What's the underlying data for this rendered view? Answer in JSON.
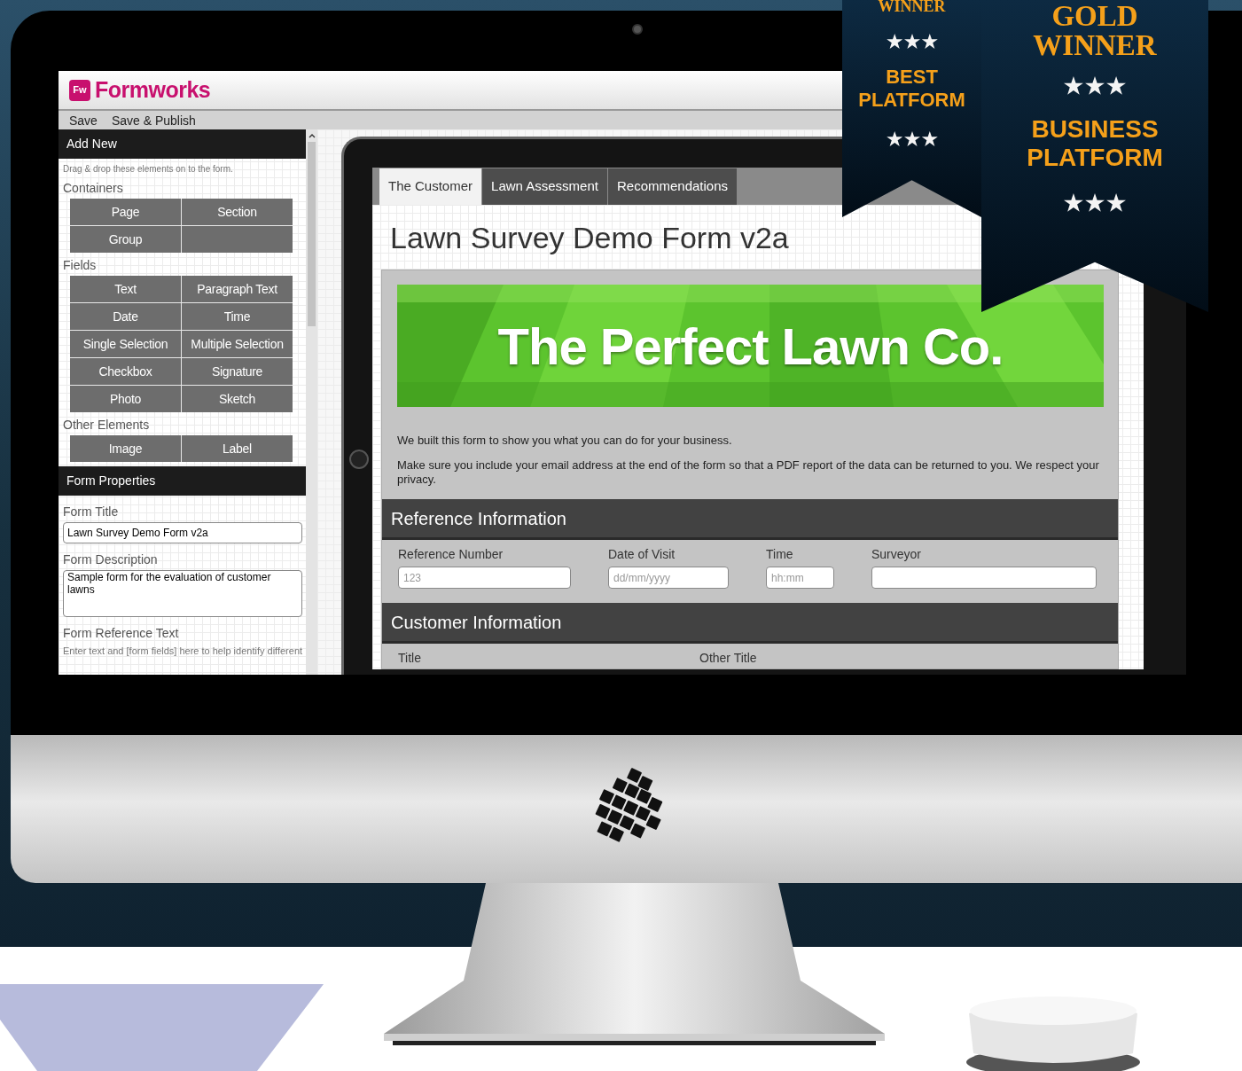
{
  "app": {
    "logo_badge": "Fw",
    "logo": "Formworks",
    "menu": [
      "Save",
      "Save & Publish"
    ],
    "add_new": {
      "title": "Add New",
      "hint": "Drag & drop these elements on to the form.",
      "groups": [
        {
          "title": "Containers",
          "items": [
            "Page",
            "Section",
            "Group"
          ]
        },
        {
          "title": "Fields",
          "items": [
            "Text",
            "Paragraph Text",
            "Date",
            "Time",
            "Single Selection",
            "Multiple Selection",
            "Checkbox",
            "Signature",
            "Photo",
            "Sketch"
          ]
        },
        {
          "title": "Other Elements",
          "items": [
            "Image",
            "Label"
          ]
        }
      ]
    },
    "form_properties": {
      "title": "Form Properties",
      "fields": [
        {
          "kind": "input",
          "label": "Form Title",
          "value": "Lawn Survey Demo Form v2a"
        },
        {
          "kind": "textarea",
          "label": "Form Description",
          "value": "Sample form for the evaluation of customer lawns"
        },
        {
          "kind": "hint",
          "label": "Form Reference Text",
          "hint": "Enter text and [form fields] here to help identify different"
        }
      ]
    }
  },
  "form": {
    "tabs": [
      {
        "label": "The Customer",
        "selected": true
      },
      {
        "label": "Lawn Assessment",
        "selected": false
      },
      {
        "label": "Recommendations",
        "selected": false
      }
    ],
    "title": "Lawn Survey Demo Form v2a",
    "banner_text": "The Perfect Lawn Co.",
    "intro": [
      "We built this form to show you what you can do for your business.",
      "Make sure you include your email address at the end of the form so that a PDF report of the data can be returned to you. We respect your privacy."
    ],
    "sections": [
      {
        "title": "Reference Information",
        "fields": [
          {
            "label": "Reference Number",
            "placeholder": "123"
          },
          {
            "label": "Date of Visit",
            "placeholder": "dd/mm/yyyy"
          },
          {
            "label": "Time",
            "placeholder": "hh:mm"
          },
          {
            "label": "Surveyor"
          }
        ]
      },
      {
        "title": "Customer Information",
        "fields": [
          {
            "label": "Title"
          },
          {
            "label": "Other Title"
          }
        ]
      }
    ]
  },
  "awards": [
    {
      "kind": "side",
      "top": [
        "WINNER"
      ],
      "bottom": [
        "BEST",
        "PLATFORM"
      ]
    },
    {
      "kind": "main",
      "top": [
        "GOLD",
        "WINNER"
      ],
      "bottom": [
        "BUSINESS",
        "PLATFORM"
      ]
    }
  ]
}
